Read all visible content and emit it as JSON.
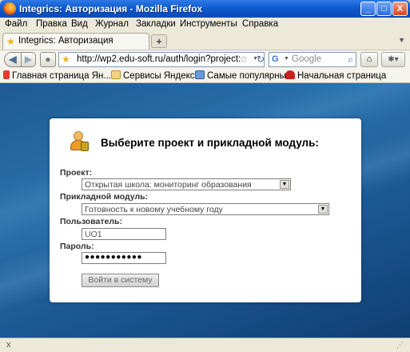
{
  "window": {
    "title": "Integrics: Авторизация - Mozilla Firefox",
    "minimize": "_",
    "maximize": "□",
    "close": "X"
  },
  "menu": [
    "Файл",
    "Правка",
    "Вид",
    "Журнал",
    "Закладки",
    "Инструменты",
    "Справка"
  ],
  "tabs": {
    "active_label": "Integrics: Авторизация",
    "new_tab": "+"
  },
  "nav": {
    "url": "http://wp2.edu-soft.ru/auth/login?project:",
    "search_placeholder": "Google"
  },
  "bookmarks": [
    {
      "label": "Главная страница Ян...",
      "icon": "yandex-icon"
    },
    {
      "label": "Сервисы Яндекса",
      "icon": "folder-icon"
    },
    {
      "label": "Самые популярные",
      "icon": "smart-bookmark-icon"
    },
    {
      "label": "Начальная страница",
      "icon": "redhat-icon"
    }
  ],
  "login": {
    "heading": "Выберите проект и прикладной модуль:",
    "project_label": "Проект:",
    "project_value": "Открытая школа: мониторинг образования",
    "module_label": "Прикладной модуль:",
    "module_value": "Готовность к новому учебному году",
    "user_label": "Пользователь:",
    "user_value": "UO1",
    "password_label": "Пароль:",
    "password_value": "●●●●●●●●●●●",
    "submit_label": "Войти в систему"
  },
  "status": {
    "left": "x"
  },
  "colors": {
    "titlebar": "#0e5bd0",
    "desktop": "#2a72ad"
  }
}
